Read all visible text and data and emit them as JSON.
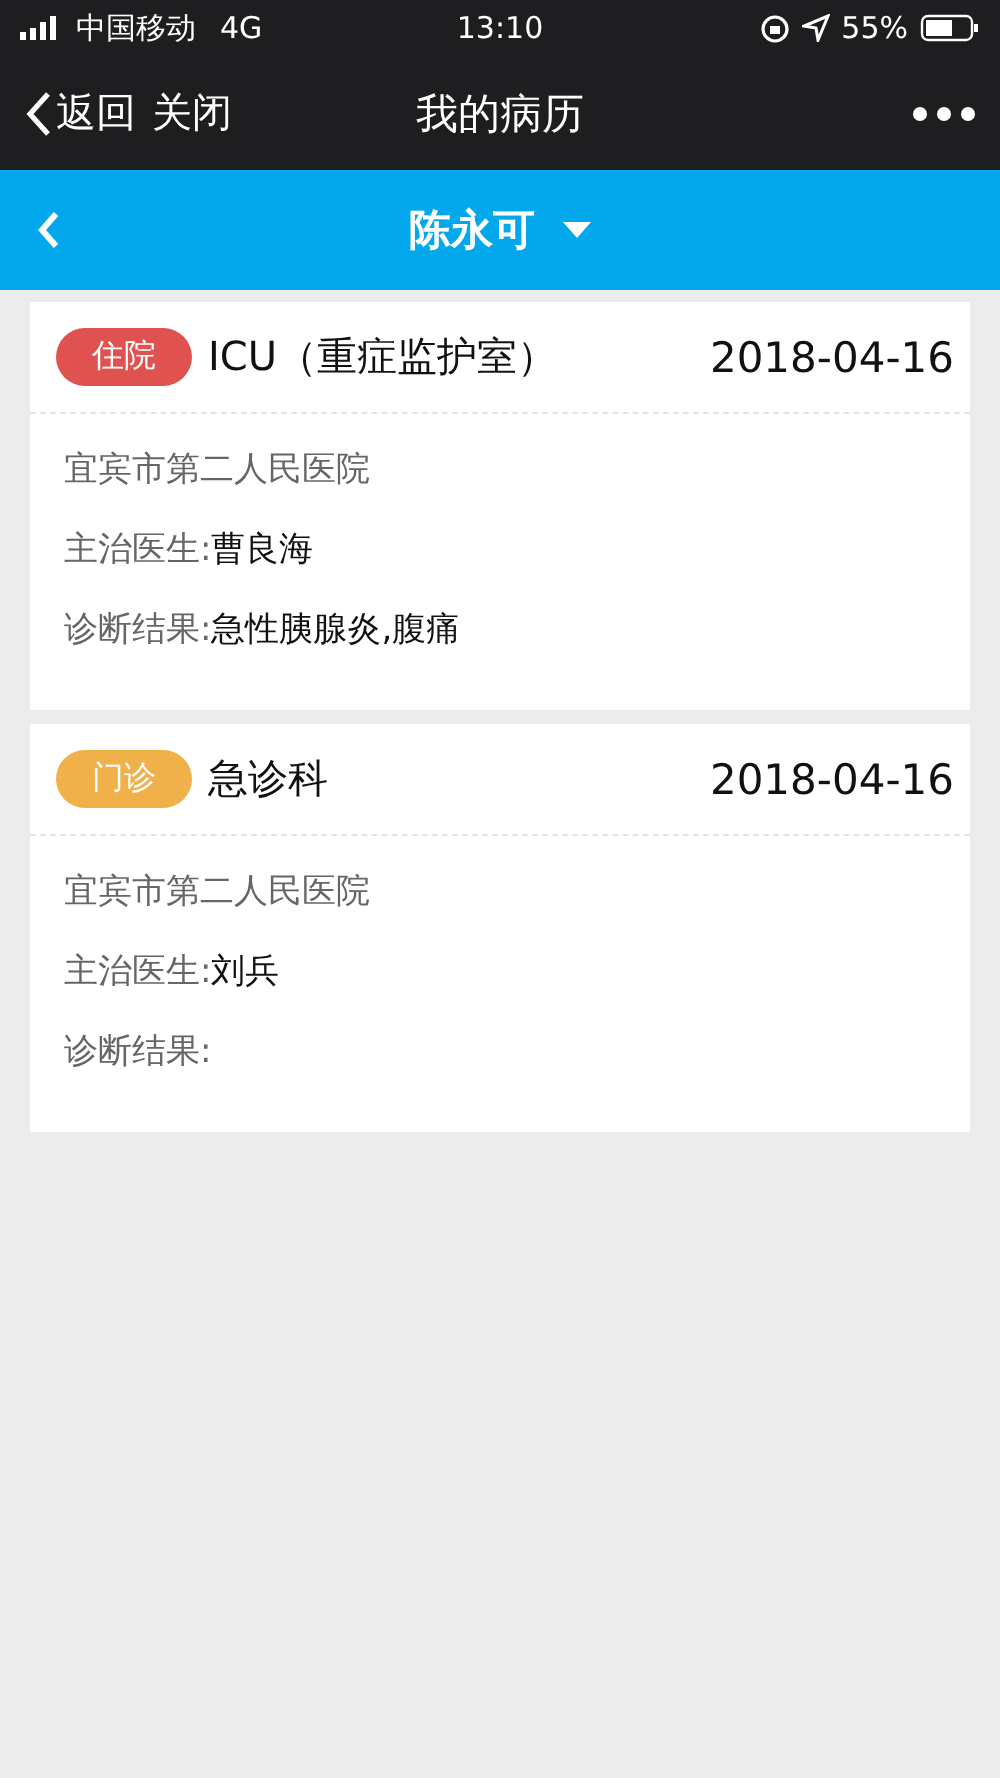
{
  "status_bar": {
    "carrier": "中国移动",
    "network": "4G",
    "time": "13:10",
    "battery": "55%"
  },
  "nav": {
    "back": "返回",
    "close": "关闭",
    "title": "我的病历"
  },
  "patient_bar": {
    "name": "陈永可"
  },
  "records": [
    {
      "tag": "住院",
      "color": "#df5250",
      "department": "ICU（重症监护室）",
      "date": "2018-04-16",
      "hospital": "宜宾市第二人民医院",
      "fields": [
        {
          "label": "主治医生:",
          "value": "曹良海"
        },
        {
          "label": "诊断结果:",
          "value": "急性胰腺炎,腹痛"
        }
      ]
    },
    {
      "tag": "门诊",
      "color": "#f0b04a",
      "department": "急诊科",
      "date": "2018-04-16",
      "hospital": "宜宾市第二人民医院",
      "fields": [
        {
          "label": "主治医生:",
          "value": "刘兵"
        },
        {
          "label": "诊断结果:"
        }
      ]
    }
  ]
}
